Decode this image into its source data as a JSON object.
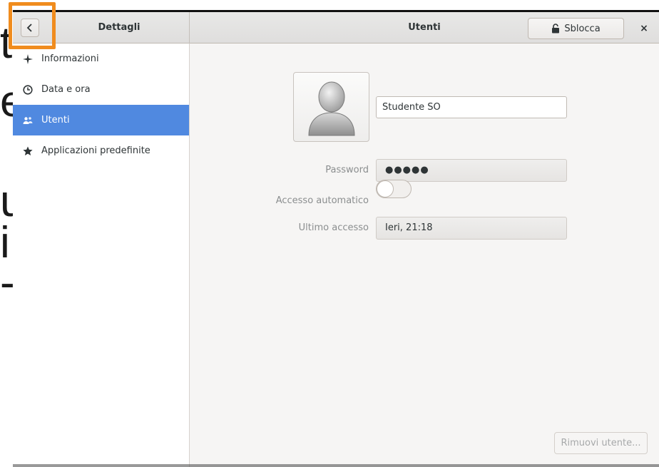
{
  "background_slide": {
    "letters": [
      "t",
      "e",
      "u",
      "i",
      "-"
    ]
  },
  "headerbar": {
    "left_title": "Dettagli",
    "main_title": "Utenti",
    "unlock_label": "Sblocca",
    "close_symbol": "×"
  },
  "sidebar": {
    "items": [
      {
        "label": "Informazioni",
        "icon": "sparkle-icon"
      },
      {
        "label": "Data e ora",
        "icon": "clock-icon"
      },
      {
        "label": "Utenti",
        "icon": "users-icon",
        "active": true
      },
      {
        "label": "Applicazioni predefinite",
        "icon": "star-icon"
      }
    ]
  },
  "user": {
    "name": "Studente SO",
    "password_label": "Password",
    "password_value": "●●●●●",
    "autologin_label": "Accesso automatico",
    "autologin_enabled": false,
    "last_login_label": "Ultimo accesso",
    "last_login_value": "Ieri, 21:18"
  },
  "actions": {
    "remove_user_label": "Rimuovi utente..."
  },
  "colors": {
    "accent": "#5089e0",
    "highlight": "#f08c1e"
  }
}
